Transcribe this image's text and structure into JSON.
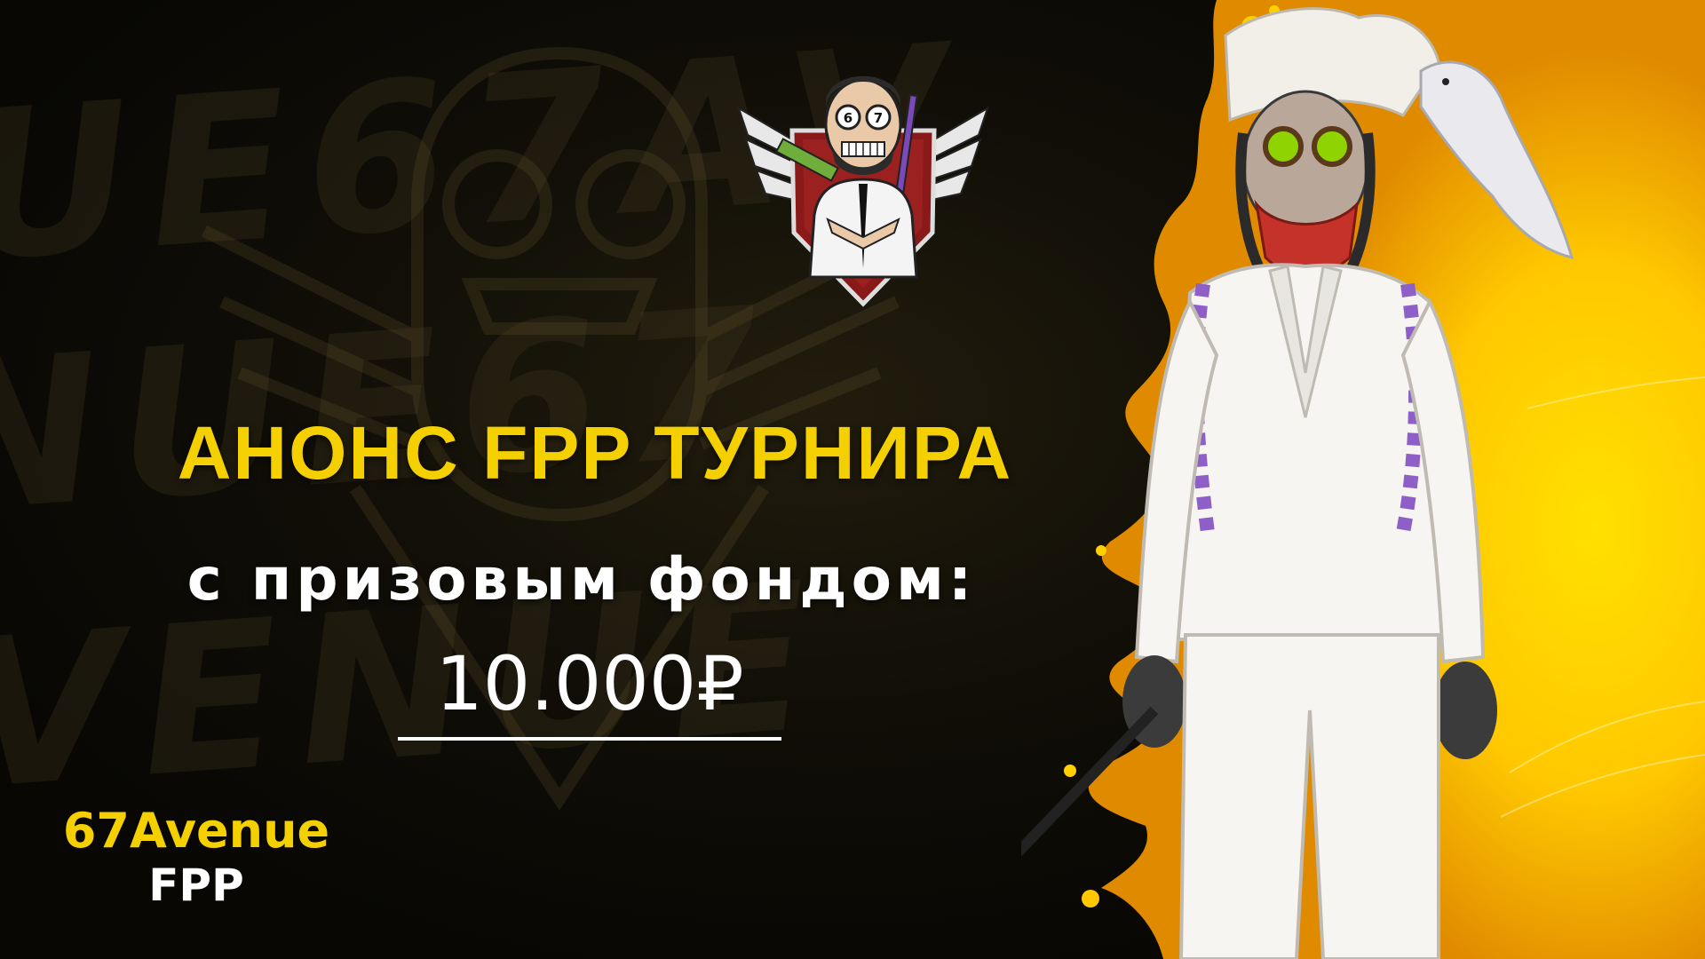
{
  "banner": {
    "headline": "АНОНС FPP ТУРНИРА",
    "subline": "с призовым фондом:",
    "prize": "10.000₽",
    "brand_name": "67Avenue",
    "brand_mode": "FPP"
  },
  "colors": {
    "accent_yellow": "#f5d000",
    "text_white": "#ffffff",
    "background_dark": "#0a0905"
  }
}
